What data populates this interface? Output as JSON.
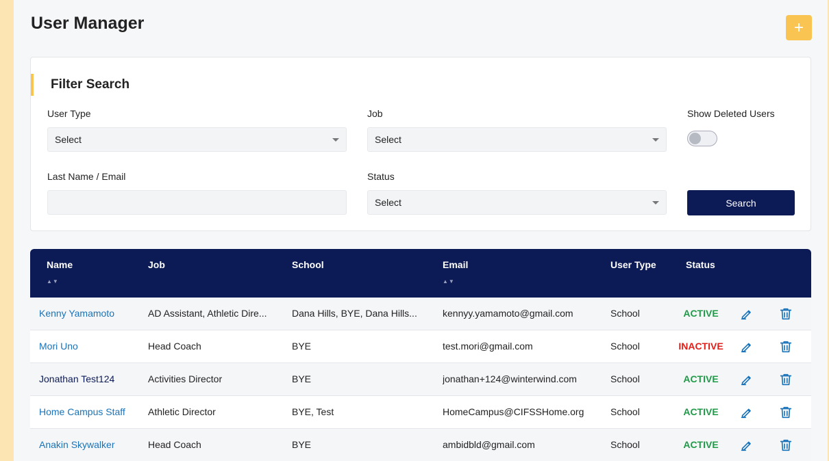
{
  "page": {
    "title": "User Manager",
    "add_label": "+"
  },
  "filter": {
    "title": "Filter Search",
    "user_type": {
      "label": "User Type",
      "value": "Select"
    },
    "job": {
      "label": "Job",
      "value": "Select"
    },
    "show_deleted": {
      "label": "Show Deleted Users",
      "on": false
    },
    "last_name_email": {
      "label": "Last Name / Email",
      "value": ""
    },
    "status": {
      "label": "Status",
      "value": "Select"
    },
    "search_label": "Search"
  },
  "table": {
    "columns": {
      "name": "Name",
      "job": "Job",
      "school": "School",
      "email": "Email",
      "user_type": "User Type",
      "status": "Status"
    },
    "sort_glyph": "▲▼",
    "rows": [
      {
        "name": "Kenny Yamamoto",
        "job": "AD Assistant, Athletic Dire...",
        "school": "Dana Hills, BYE, Dana Hills...",
        "email": "kennyy.yamamoto@gmail.com",
        "user_type": "School",
        "status": "ACTIVE"
      },
      {
        "name": "Mori Uno",
        "job": "Head Coach",
        "school": "BYE",
        "email": "test.mori@gmail.com",
        "user_type": "School",
        "status": "INACTIVE"
      },
      {
        "name": "Jonathan Test124",
        "job": "Activities Director",
        "school": "BYE",
        "email": "jonathan+124@winterwind.com",
        "user_type": "School",
        "status": "ACTIVE"
      },
      {
        "name": "Home Campus Staff",
        "job": "Athletic Director",
        "school": "BYE, Test",
        "email": "HomeCampus@CIFSSHome.org",
        "user_type": "School",
        "status": "ACTIVE"
      },
      {
        "name": "Anakin Skywalker",
        "job": "Head Coach",
        "school": "BYE",
        "email": "ambidbld@gmail.com",
        "user_type": "School",
        "status": "ACTIVE"
      }
    ]
  },
  "colors": {
    "accent": "#f9c452",
    "navy": "#0c1a56",
    "link": "#1a73b8",
    "active": "#1e9b47",
    "inactive": "#e0201a"
  },
  "icons": {
    "edit": "pencil-icon",
    "delete": "trash-icon",
    "dropdown": "caret-down-icon"
  }
}
